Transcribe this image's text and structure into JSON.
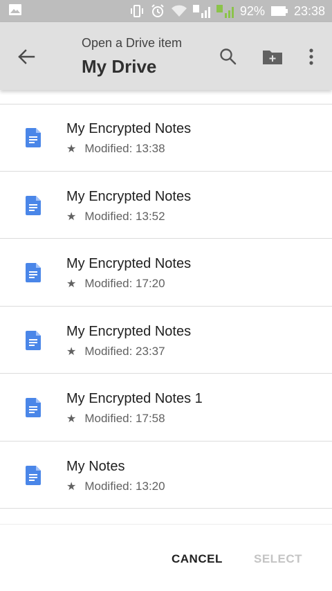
{
  "status_bar": {
    "battery": "92%",
    "time": "23:38",
    "sim1": "1",
    "sim2": "2"
  },
  "app_bar": {
    "subtitle": "Open a Drive item",
    "title": "My Drive",
    "icons": [
      "back-arrow-icon",
      "search-icon",
      "new-folder-icon",
      "more-vert-icon"
    ]
  },
  "files": [
    {
      "name": "My Encrypted Notes",
      "meta": "Modified: 13:38"
    },
    {
      "name": "My Encrypted Notes",
      "meta": "Modified: 13:52"
    },
    {
      "name": "My Encrypted Notes",
      "meta": "Modified: 17:20"
    },
    {
      "name": "My Encrypted Notes",
      "meta": "Modified: 23:37"
    },
    {
      "name": "My Encrypted Notes 1",
      "meta": "Modified: 17:58"
    },
    {
      "name": "My Notes",
      "meta": "Modified: 13:20"
    }
  ],
  "footer": {
    "cancel_label": "CANCEL",
    "select_label": "SELECT"
  },
  "colors": {
    "doc_icon": "#4a86e8",
    "app_bar": "#e0e0e0",
    "status_bar": "#bdbdbd",
    "disabled": "#c4c4c4"
  }
}
